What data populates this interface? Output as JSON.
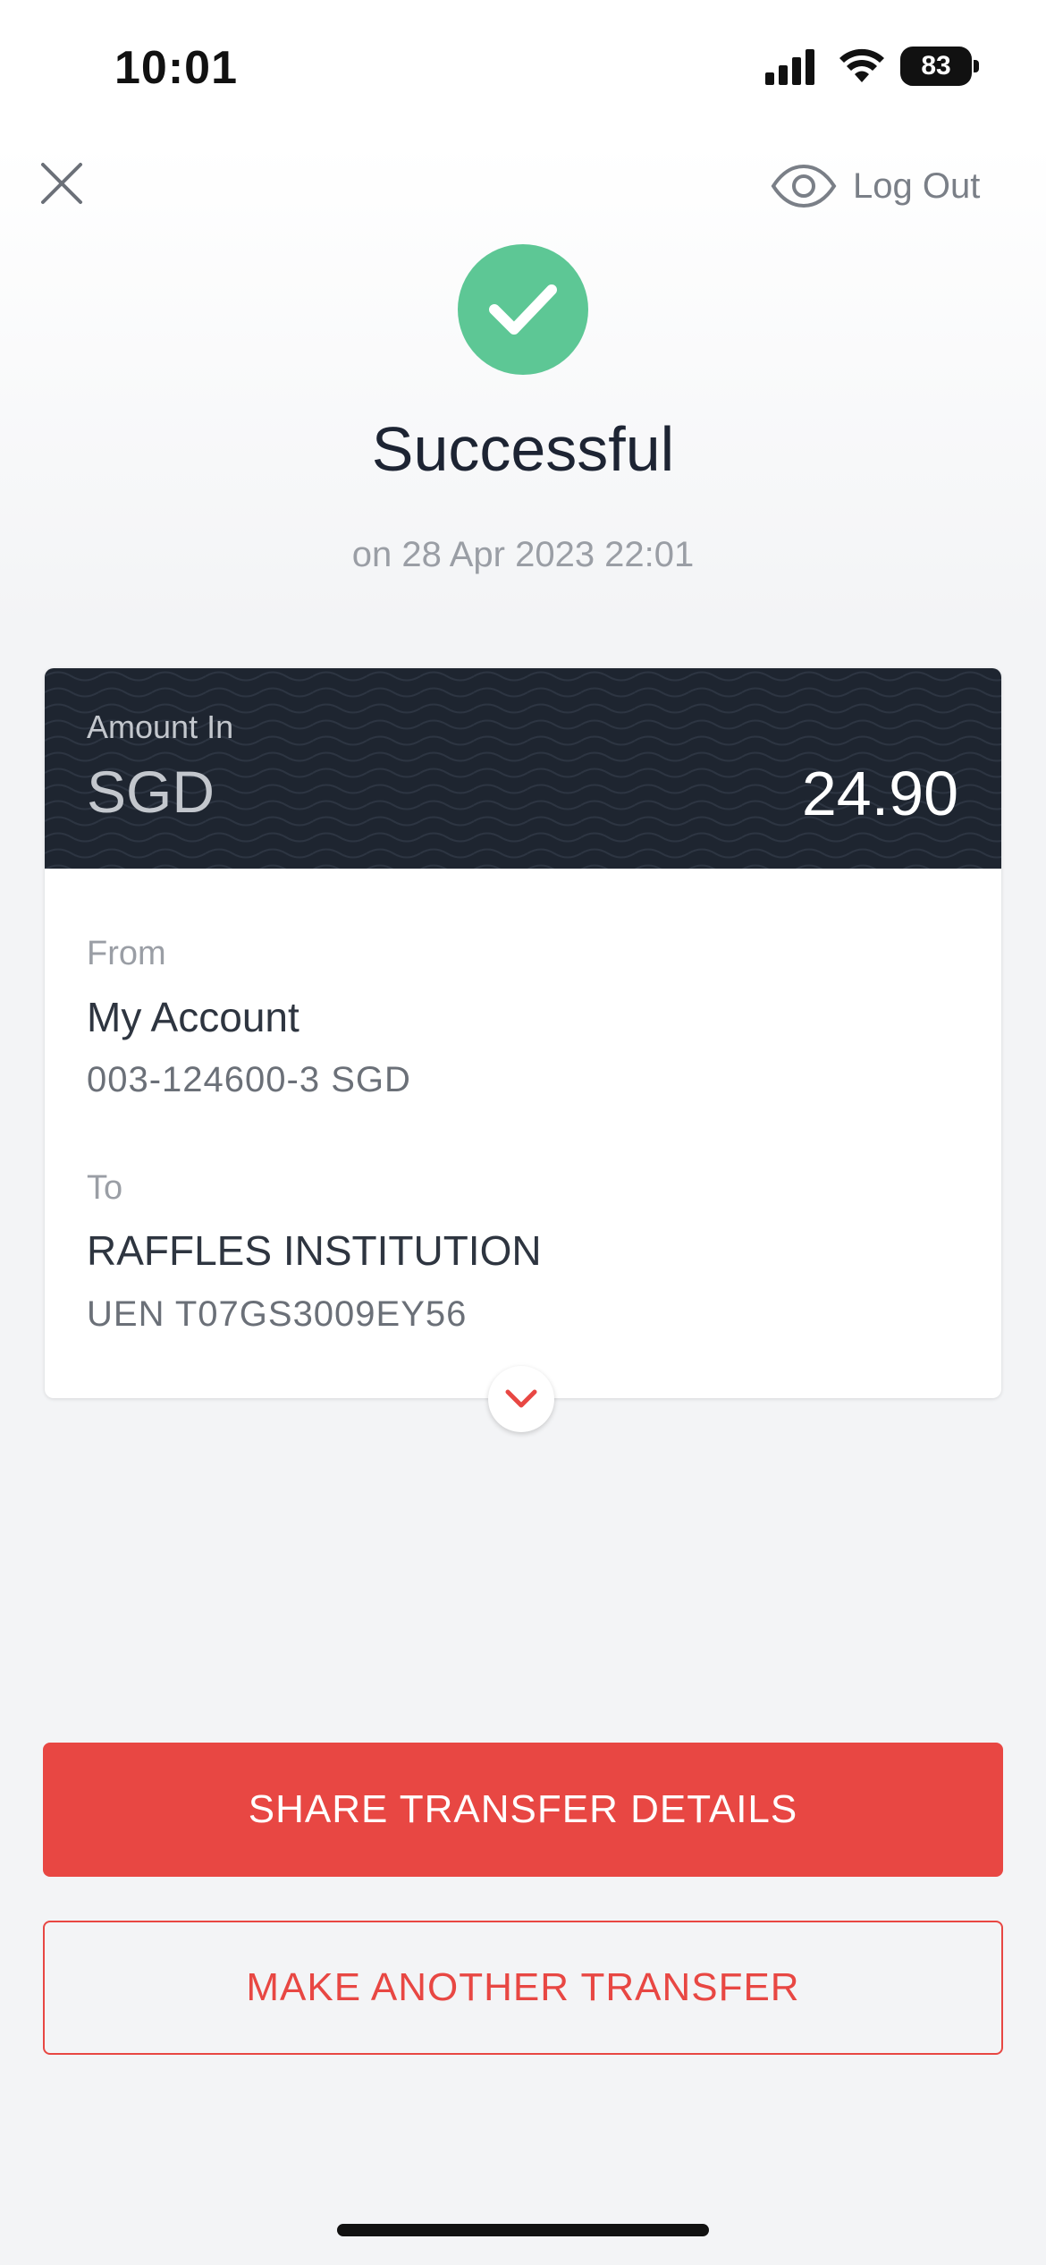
{
  "status_bar": {
    "time": "10:01",
    "battery": "83",
    "icons": [
      "signal-icon",
      "wifi-icon",
      "battery-icon"
    ]
  },
  "header": {
    "close_icon": "close-icon",
    "logout_icon": "eye-icon",
    "logout_label": "Log Out"
  },
  "result": {
    "status_icon": "checkmark-icon",
    "title": "Successful",
    "timestamp": "on 28 Apr 2023 22:01"
  },
  "card": {
    "amount_label": "Amount In",
    "currency": "SGD",
    "amount": "24.90",
    "from": {
      "label": "From",
      "name": "My Account",
      "detail": "003-124600-3 SGD"
    },
    "to": {
      "label": "To",
      "name": "RAFFLES INSTITUTION",
      "detail": "UEN T07GS3009EY56"
    },
    "expand_icon": "chevron-down-icon"
  },
  "actions": {
    "share_label": "SHARE TRANSFER DETAILS",
    "another_label": "MAKE ANOTHER TRANSFER"
  },
  "colors": {
    "success": "#5dc795",
    "accent": "#e84743",
    "card_header": "#1e2530"
  }
}
